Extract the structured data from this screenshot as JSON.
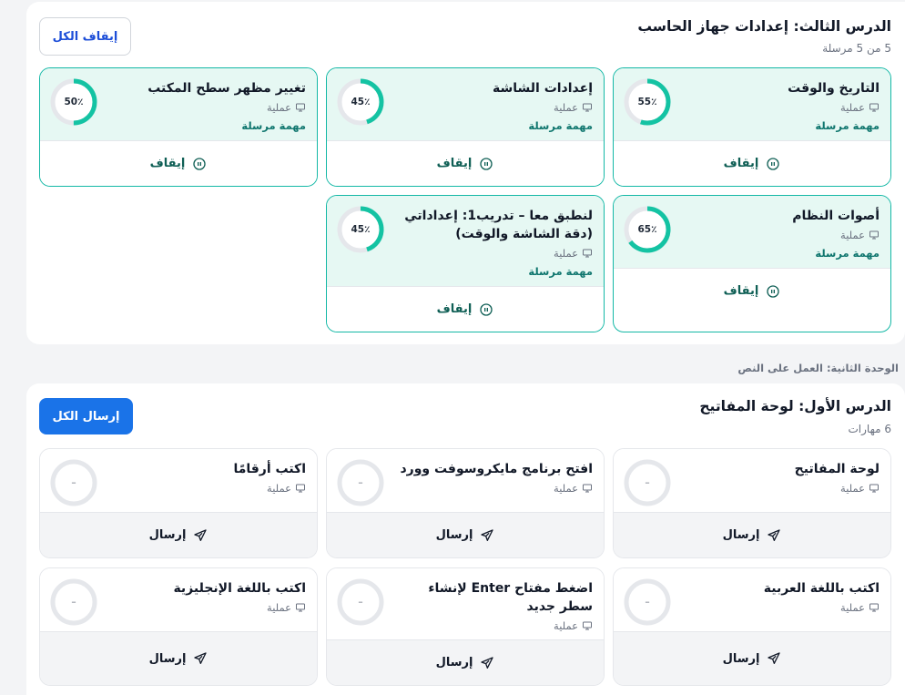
{
  "lesson3": {
    "title": "الدرس الثالث: إعدادات جهاز الحاسب",
    "subtitle": "5 من 5 مرسلة",
    "stop_all_label": "إيقاف الكل",
    "cards": [
      {
        "title": "التاريخ والوقت",
        "type": "عملية",
        "status": "مهمة مرسلة",
        "progress_label": "55٪",
        "progress": 55,
        "action": "إيقاف"
      },
      {
        "title": "إعدادات الشاشة",
        "type": "عملية",
        "status": "مهمة مرسلة",
        "progress_label": "45٪",
        "progress": 45,
        "action": "إيقاف"
      },
      {
        "title": "تغيير مظهر سطح المكتب",
        "type": "عملية",
        "status": "مهمة مرسلة",
        "progress_label": "50٪",
        "progress": 50,
        "action": "إيقاف"
      },
      {
        "title": "أصوات النظام",
        "type": "عملية",
        "status": "مهمة مرسلة",
        "progress_label": "65٪",
        "progress": 65,
        "action": "إيقاف"
      },
      {
        "title": "لنطبق معا – تدريب1: إعداداتي (دقة الشاشة والوقت)",
        "type": "عملية",
        "status": "مهمة مرسلة",
        "progress_label": "45٪",
        "progress": 45,
        "action": "إيقاف"
      }
    ]
  },
  "unit2_label": "الوحدة الثانية: العمل على النص",
  "lesson1": {
    "title": "الدرس الأول: لوحة المفاتيح",
    "subtitle": "6 مهارات",
    "send_all_label": "إرسال الكل",
    "cards": [
      {
        "title": "لوحة المفاتيح",
        "type": "عملية",
        "progress_label": "–",
        "action": "إرسال"
      },
      {
        "title": "افتح برنامج مايكروسوفت وورد",
        "type": "عملية",
        "progress_label": "–",
        "action": "إرسال"
      },
      {
        "title": "اكتب أرقامًا",
        "type": "عملية",
        "progress_label": "–",
        "action": "إرسال"
      },
      {
        "title": "اكتب باللغة العربية",
        "type": "عملية",
        "progress_label": "–",
        "action": "إرسال"
      },
      {
        "title": "اضغط مفتاح Enter لإنشاء سطر جديد",
        "type": "عملية",
        "progress_label": "–",
        "action": "إرسال"
      },
      {
        "title": "اكتب باللغة الإنجليزية",
        "type": "عملية",
        "progress_label": "–",
        "action": "إرسال"
      }
    ]
  },
  "colors": {
    "accent_teal": "#14b8a6",
    "status_teal": "#0f766e",
    "primary_blue": "#1a73e8",
    "active_card_bg": "#e6f8f3"
  },
  "icons": {
    "type": "monitor-icon",
    "stop": "pause-circle-icon",
    "send": "send-icon"
  }
}
